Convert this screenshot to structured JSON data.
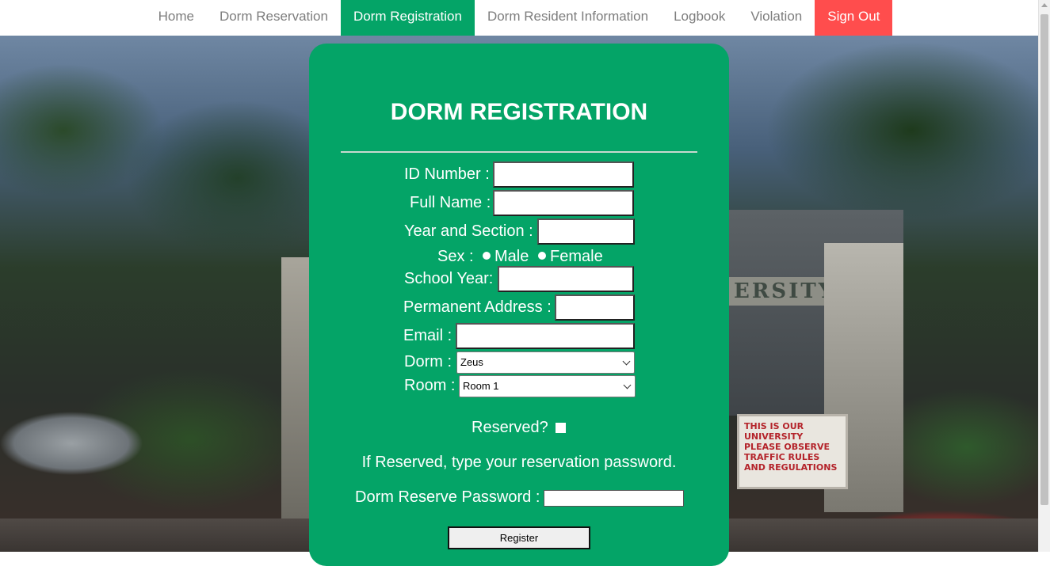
{
  "nav": {
    "items": [
      {
        "label": "Home"
      },
      {
        "label": "Dorm Reservation"
      },
      {
        "label": "Dorm Registration"
      },
      {
        "label": "Dorm Resident Information"
      },
      {
        "label": "Logbook"
      },
      {
        "label": "Violation"
      },
      {
        "label": "Sign Out"
      }
    ],
    "active_color": "#04a467",
    "signout_color": "#ff4d4d"
  },
  "background": {
    "sign_text": "ERSITY",
    "board_text": "THIS IS OUR UNIVERSITY PLEASE OBSERVE TRAFFIC RULES AND REGULATIONS"
  },
  "form": {
    "title": "DORM REGISTRATION",
    "id_number_label": "ID Number :",
    "id_number_value": "",
    "full_name_label": "Full Name :",
    "full_name_value": "",
    "year_section_label": "Year and Section :",
    "year_section_value": "",
    "sex_label": "Sex :",
    "sex_options": {
      "male": "Male",
      "female": "Female"
    },
    "school_year_label": "School Year:",
    "school_year_value": "",
    "address_label": "Permanent Address :",
    "address_value": "",
    "email_label": "Email :",
    "email_value": "",
    "dorm_label": "Dorm :",
    "dorm_selected": "Zeus",
    "room_label": "Room :",
    "room_selected": "Room 1",
    "reserved_label": "Reserved?",
    "reserved_note": "If Reserved, type your reservation password.",
    "reserve_password_label": "Dorm Reserve Password :",
    "register_label": "Register",
    "panel_color": "#04a467"
  }
}
